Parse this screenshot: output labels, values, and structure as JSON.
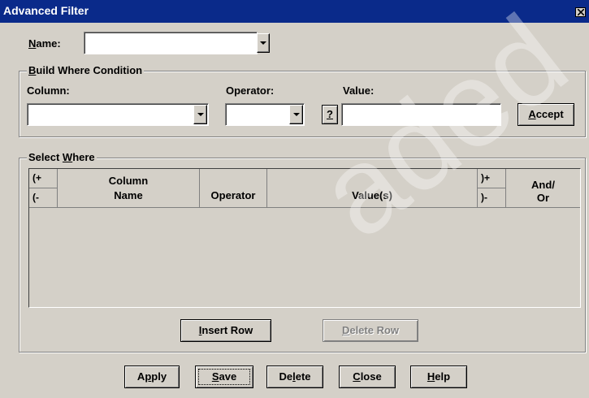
{
  "window": {
    "title": "Advanced Filter",
    "close_icon": "close-icon"
  },
  "name_row": {
    "label_pre": "",
    "label_mnemonic": "N",
    "label_post": "ame:",
    "value": ""
  },
  "build_where": {
    "group_label_mnemonic": "B",
    "group_label_post": "uild Where Condition",
    "column_label": "Column:",
    "operator_label": "Operator:",
    "value_label": "Value:",
    "column_value": "",
    "operator_value": "",
    "value_value": "",
    "lookup_button": "?",
    "accept_mnemonic": "A",
    "accept_post": "ccept"
  },
  "select_where": {
    "group_label_pre": "Select ",
    "group_label_mnemonic": "W",
    "group_label_post": "here",
    "columns": {
      "open_paren_top": "(+",
      "open_paren_bottom": "(-",
      "column_name_l1": "Column",
      "column_name_l2": "Name",
      "operator": "Operator",
      "values": "Value(s)",
      "close_paren_top": ")+",
      "close_paren_bottom": ")-",
      "and_or_l1": "And/",
      "and_or_l2": "Or"
    },
    "rows": [],
    "insert_mnemonic": "I",
    "insert_post": "nsert Row",
    "delete_mnemonic": "D",
    "delete_post": "elete Row"
  },
  "footer": {
    "apply_pre": "A",
    "apply_mnemonic": "p",
    "apply_post": "ply",
    "save_mnemonic": "S",
    "save_post": "ave",
    "delete_pre": "De",
    "delete_mnemonic": "l",
    "delete_post": "ete",
    "close_mnemonic": "C",
    "close_post": "lose",
    "help_mnemonic": "H",
    "help_post": "elp"
  },
  "watermark": "aded"
}
